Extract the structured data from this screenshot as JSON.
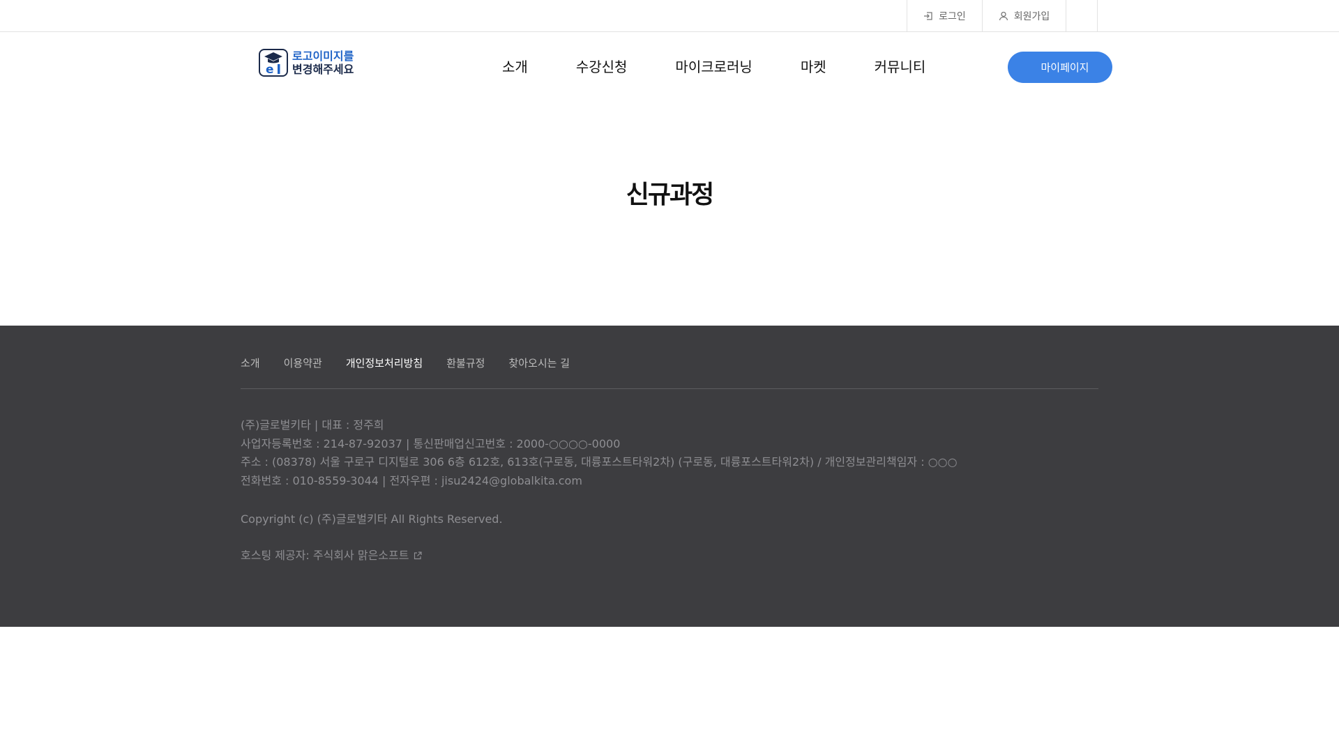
{
  "topbar": {
    "login_label": "로그인",
    "join_label": "회원가입"
  },
  "header": {
    "logo": {
      "line1": "로고이미지를",
      "line2": "변경해주세요"
    },
    "nav": [
      "소개",
      "수강신청",
      "마이크로러닝",
      "마켓",
      "커뮤니티"
    ],
    "mypage_label": "마이페이지"
  },
  "main": {
    "title": "신규과정"
  },
  "footer": {
    "nav": [
      "소개",
      "이용약관",
      "개인정보처리방침",
      "환불규정",
      "찾아오시는 길"
    ],
    "active_nav": "개인정보처리방침",
    "info_lines": [
      "(주)글로벌키타 | 대표 : 정주희",
      "사업자등록번호 : 214-87-92037 | 통신판매업신고번호 : 2000-○○○○-0000",
      "주소 : (08378) 서울 구로구 디지털로 306 6층 612호, 613호(구로동, 대륭포스트타워2차) (구로동, 대륭포스트타워2차) / 개인정보관리책임자 : ○○○",
      "전화번호 : 010-8559-3044 | 전자우편 : jisu2424@globalkita.com"
    ],
    "copyright": "Copyright (c) (주)글로벌키타 All Rights Reserved.",
    "hosting": "호스팅 제공자: 주식회사 맑은소프트"
  },
  "colors": {
    "accent": "#3b82e6",
    "footer_bg": "#3d3d40",
    "logo_blue": "#1f63c7",
    "logo_navy": "#1b2a4a"
  },
  "icons": {
    "login": "login-icon",
    "join": "user-icon",
    "hosting": "external-link-icon"
  }
}
